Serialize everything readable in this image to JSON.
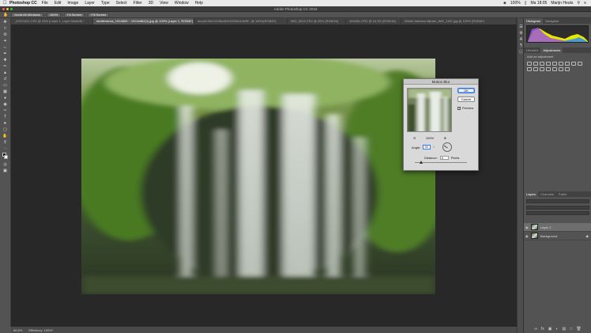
{
  "menubar": {
    "apple_icon": "apple-icon",
    "app_name": "Photoshop CC",
    "items": [
      "File",
      "Edit",
      "Image",
      "Layer",
      "Type",
      "Select",
      "Filter",
      "3D",
      "View",
      "Window",
      "Help"
    ],
    "battery": "100%",
    "clock": "Ma 18:05",
    "user": "Marijn Heuts"
  },
  "window": {
    "title": "Adobe Photoshop CC 2019"
  },
  "options": {
    "buttons": [
      "Scroll All Windows",
      "100%",
      "Fit Screen",
      "Fill Screen"
    ]
  },
  "tabs": [
    "_DSC0421.CR2 @ 33% (Layer 1, Layer Mask/8) *",
    "shutterstock_1924653 ~ 1024x682(1).jpg @ 100% (Layer 1, RGB/8*)",
    "deca1133e21198cd21f15326d14e9ff...@ 100%(RGB/8*)",
    "IMG_6022.CR2 @ 25% (RGB/16)",
    "1f4430c.CR2 @ 16,3% (RGB/16)",
    "Winter bamboo bijharn_IMG_1187.jpg @ 100% (RGB/8*)"
  ],
  "panels": {
    "top_tabs": [
      "Histogram",
      "Navigator"
    ],
    "mid_tabs": [
      "Libraries",
      "Adjustments"
    ],
    "adjust_hint": "Add an adjustment",
    "layers_tabs": [
      "Layers",
      "Channels",
      "Paths"
    ],
    "layers": [
      {
        "name": "Layer 1",
        "selected": true
      },
      {
        "name": "Background",
        "selected": false
      }
    ]
  },
  "dialog": {
    "title": "Motion Blur",
    "ok": "OK",
    "cancel": "Cancel",
    "preview_label": "Preview",
    "zoom": "100%",
    "angle_label": "Angle:",
    "angle_value": "32",
    "angle_unit": "°",
    "distance_label": "Distance:",
    "distance_value": "0",
    "distance_unit": "Pixels"
  },
  "status": {
    "zoom": "66,6%",
    "info": "Efficiency: 100%*"
  },
  "colors": {
    "canvas_bg": "#282828",
    "panel_bg": "#535353",
    "dialog_bg": "#d9d9d9",
    "accent": "#2f73d8"
  },
  "toolbar_icons": [
    "move-icon",
    "marquee-icon",
    "lasso-icon",
    "quick-select-icon",
    "crop-icon",
    "eyedropper-icon",
    "healing-icon",
    "brush-icon",
    "stamp-icon",
    "history-brush-icon",
    "eraser-icon",
    "gradient-icon",
    "blur-icon",
    "dodge-icon",
    "pen-icon",
    "type-icon",
    "path-select-icon",
    "shape-icon",
    "hand-icon",
    "zoom-icon",
    "more-icon",
    "colors-icon",
    "quickmask-icon",
    "screenmode-icon"
  ]
}
